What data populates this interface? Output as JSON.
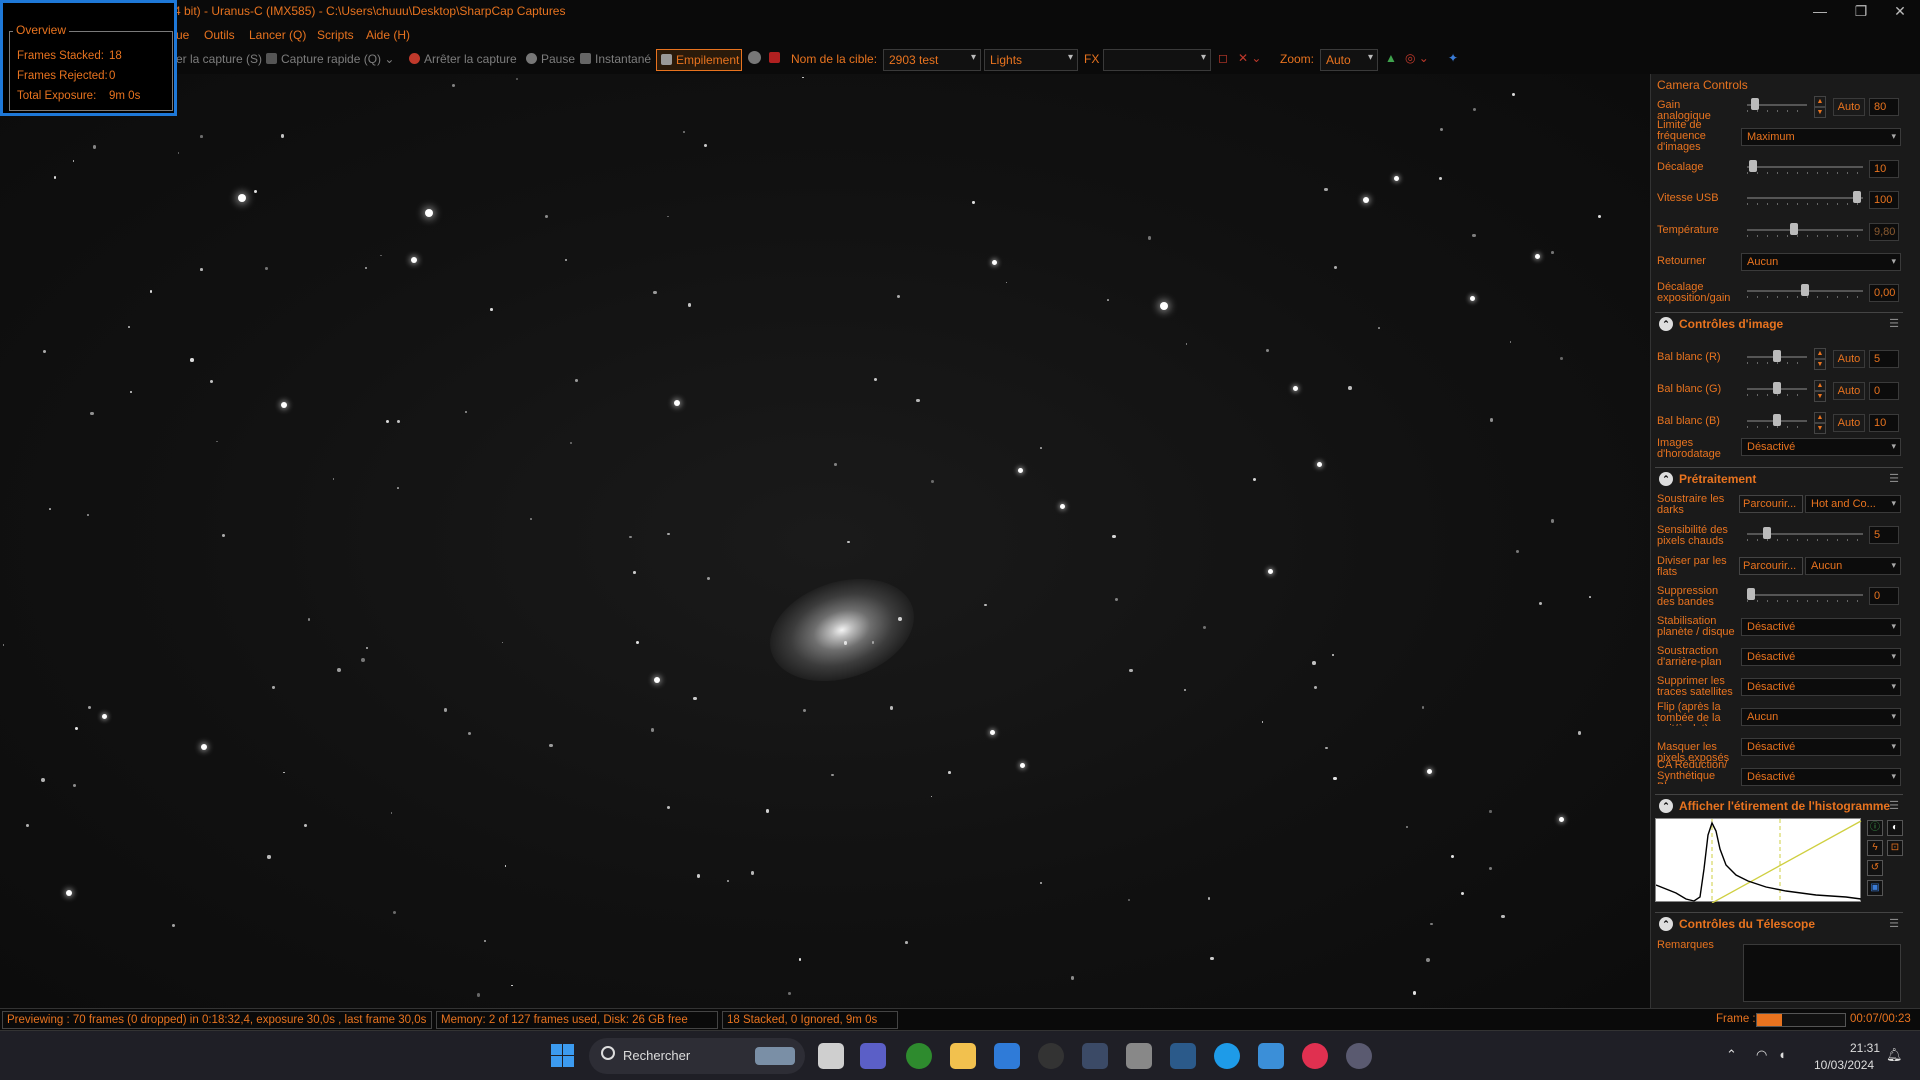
{
  "window": {
    "title": "4 bit) - Uranus-C (IMX585) - C:\\Users\\chuuu\\Desktop\\SharpCap Captures",
    "controls": [
      "—",
      "❐",
      "✕"
    ]
  },
  "menu": [
    "ue",
    "Outils",
    "Lancer (Q)",
    "Scripts",
    "Aide (H)"
  ],
  "toolbar": {
    "capture": "er la capture (S)",
    "quick_capture": "Capture rapide (Q)",
    "stop": "Arrêter la capture",
    "pause": "Pause",
    "snapshot": "Instantané",
    "stacking": "Empilement",
    "target_label": "Nom de la cible:",
    "target_value": "2903 test",
    "frame_type": "Lights",
    "fx_label": "FX",
    "fx_value": "",
    "zoom_label": "Zoom:",
    "zoom_value": "Auto"
  },
  "overview": {
    "title": "Overview",
    "frames_stacked_label": "Frames Stacked:",
    "frames_stacked": "18",
    "frames_rejected_label": "Frames Rejected:",
    "frames_rejected": "0",
    "total_exposure_label": "Total Exposure:",
    "total_exposure": "9m 0s"
  },
  "camera_controls": {
    "title": "Camera Controls",
    "gain_label": "Gain analogique",
    "gain_auto": "Auto",
    "gain_value": "80",
    "gain_level": 0.08,
    "frame_rate_label": "Limite de fréquence d'images",
    "frame_rate_value": "Maximum",
    "offset_label": "Décalage",
    "offset_value": "10",
    "offset_level": 0.02,
    "usb_label": "Vitesse USB",
    "usb_value": "100",
    "usb_level": 0.98,
    "temp_label": "Température",
    "temp_value": "9,80",
    "temp_level": 0.4,
    "flip_label": "Retourner",
    "flip_value": "Aucun",
    "exp_offset_label": "Décalage exposition/gain",
    "exp_offset_value": "0,00",
    "exp_offset_level": 0.5
  },
  "image_controls": {
    "title": "Contrôles d'image",
    "wb_r_label": "Bal blanc (R)",
    "wb_r_value": "5",
    "wb_g_label": "Bal blanc (G)",
    "wb_g_value": "0",
    "wb_b_label": "Bal blanc (B)",
    "wb_b_value": "10",
    "auto": "Auto",
    "timestamp_label": "Images d'horodatage",
    "timestamp_value": "Désactivé"
  },
  "preprocessing": {
    "title": "Prétraitement",
    "darks_label": "Soustraire les darks",
    "darks_browse": "Parcourir...",
    "darks_value": "Hot and Co...",
    "hot_pixel_label": "Sensibilité des pixels chauds",
    "hot_pixel_value": "5",
    "flats_label": "Diviser par les flats",
    "flats_browse": "Parcourir...",
    "flats_value": "Aucun",
    "banding_label": "Suppression des bandes",
    "banding_value": "0",
    "stabilization_label": "Stabilisation planète / disque",
    "stabilization_value": "Désactivé",
    "background_label": "Soustraction d'arrière-plan",
    "background_value": "Désactivé",
    "satellite_label": "Supprimer les traces satellites",
    "satellite_value": "Désactivé",
    "flip_label": "Flip (après la tombée de la nuit/à plat)",
    "flip_value": "Aucun",
    "mask_label": "Masquer les pixels exposés",
    "mask_value": "Désactivé",
    "ca_label": "CA Réduction/ Synthétique Bleu",
    "ca_value": "Désactivé"
  },
  "histogram": {
    "title": "Afficher l'étirement de l'histogramme"
  },
  "telescope": {
    "title": "Contrôles du Télescope",
    "remarks_label": "Remarques"
  },
  "status": {
    "preview": "Previewing : 70 frames (0 dropped) in 0:18:32,4, exposure 30,0s , last frame 30,0s",
    "memory": "Memory: 2 of 127 frames used, Disk: 26 GB free",
    "stacked": "18 Stacked, 0 Ignored, 9m 0s",
    "frame_label": "Frame :",
    "frame_time": "00:07/00:23",
    "frame_progress": 0.28
  },
  "taskbar": {
    "search_placeholder": "Rechercher",
    "time": "21:31",
    "date": "10/03/2024"
  }
}
